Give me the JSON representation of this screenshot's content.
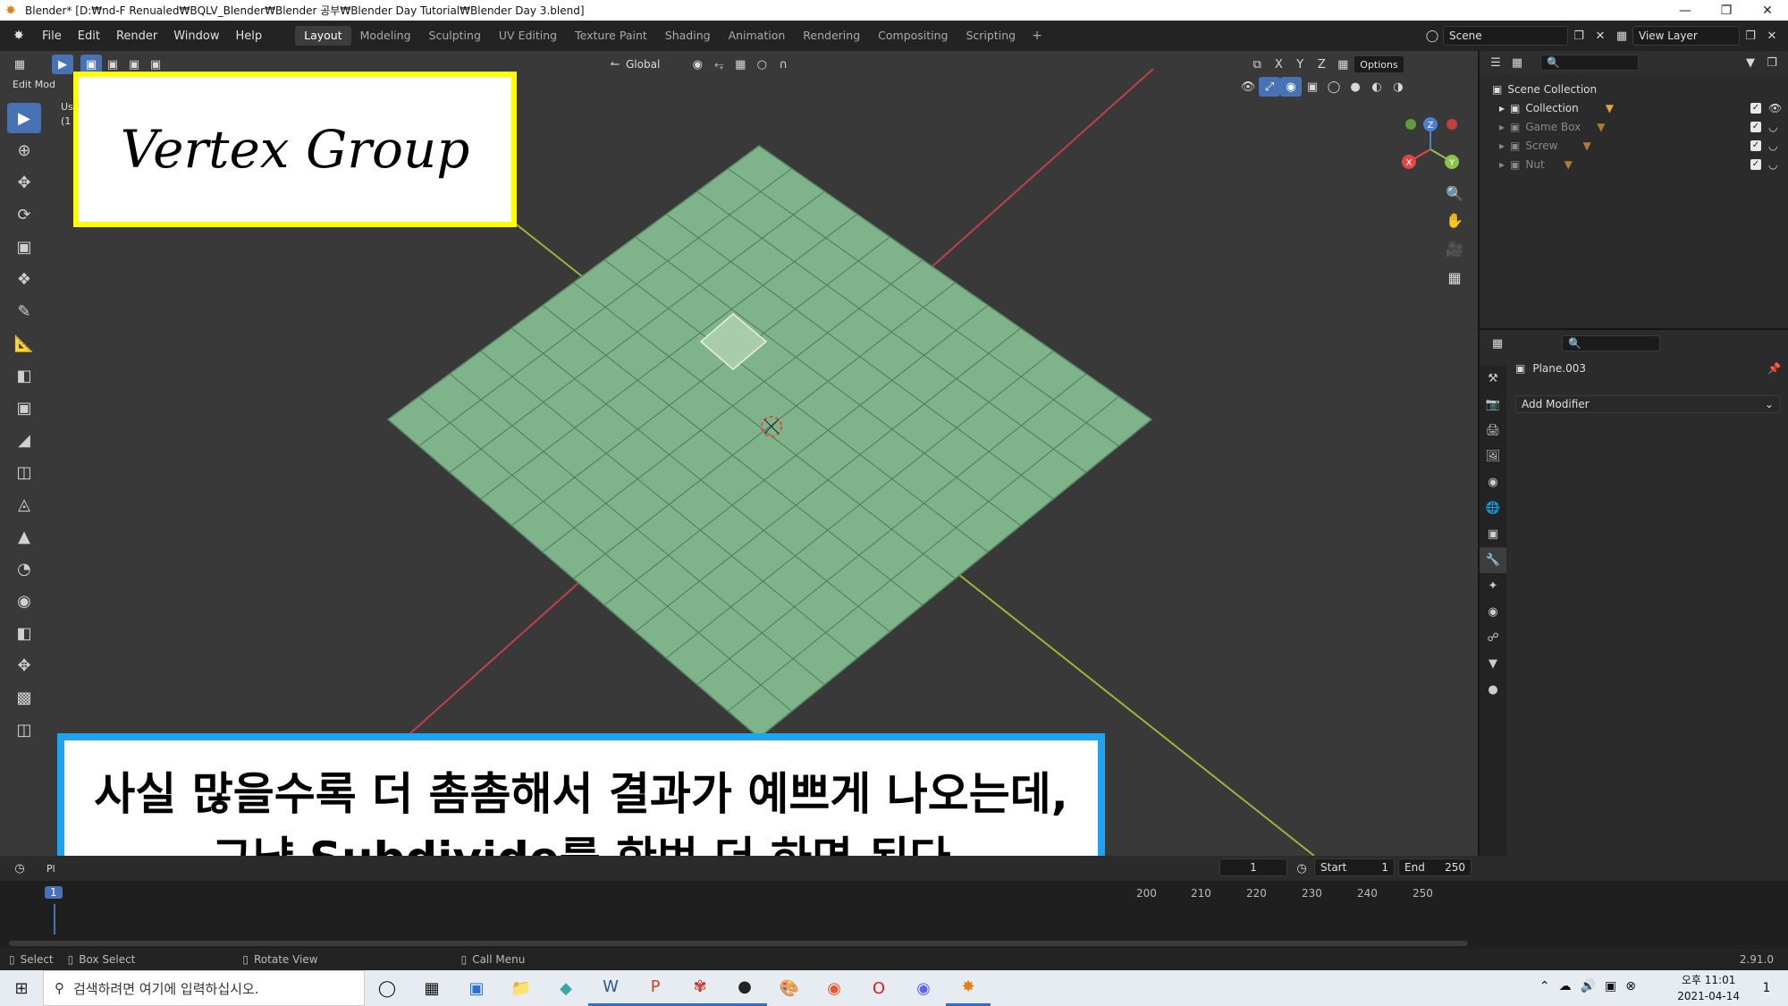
{
  "window": {
    "title": "Blender* [D:₩nd-F Renualed₩BQLV_Blender₩Blender 공부₩Blender Day Tutorial₩Blender Day 3.blend]"
  },
  "menubar": {
    "items": [
      "File",
      "Edit",
      "Render",
      "Window",
      "Help"
    ],
    "workspaces": [
      "Layout",
      "Modeling",
      "Sculpting",
      "UV Editing",
      "Texture Paint",
      "Shading",
      "Animation",
      "Rendering",
      "Compositing",
      "Scripting"
    ],
    "active_workspace": "Layout",
    "scene": "Scene",
    "view_layer": "View Layer"
  },
  "viewport": {
    "mode": "Edit Mod",
    "transform_orientation": "Global",
    "axes": [
      "X",
      "Y",
      "Z"
    ],
    "options_label": "Options",
    "partial_text_1": "Us",
    "partial_text_2": "(1",
    "mesh_color": "#7fb38a",
    "selected_face_color": "#a9cda9"
  },
  "overlays": {
    "title": "Vertex Group",
    "caption_line1": "사실 많을수록 더 촘촘해서 결과가 예쁘게 나오는데,",
    "caption_line2": "그냥 Subdivide를 한번 더 하면 된다"
  },
  "outliner": {
    "root": "Scene Collection",
    "items": [
      {
        "label": "Collection",
        "dim": false
      },
      {
        "label": "Game Box",
        "dim": true
      },
      {
        "label": "Screw",
        "dim": true
      },
      {
        "label": "Nut",
        "dim": true
      }
    ]
  },
  "properties": {
    "object_name": "Plane.003",
    "add_modifier": "Add Modifier"
  },
  "timeline": {
    "current_frame": "1",
    "start_label": "Start",
    "start": "1",
    "end_label": "End",
    "end": "250",
    "ruler_left": "1",
    "ruler_ticks": [
      "200",
      "210",
      "220",
      "230",
      "240",
      "250"
    ],
    "editor_partial": "Pl"
  },
  "statusbar": {
    "select": "Select",
    "box_select": "Box Select",
    "rotate_view": "Rotate View",
    "call_menu": "Call Menu",
    "version": "2.91.0"
  },
  "taskbar": {
    "search_placeholder": "검색하려면 여기에 입력하십시오.",
    "time": "오후 11:01",
    "date": "2021-04-14",
    "notif_count": "1"
  }
}
